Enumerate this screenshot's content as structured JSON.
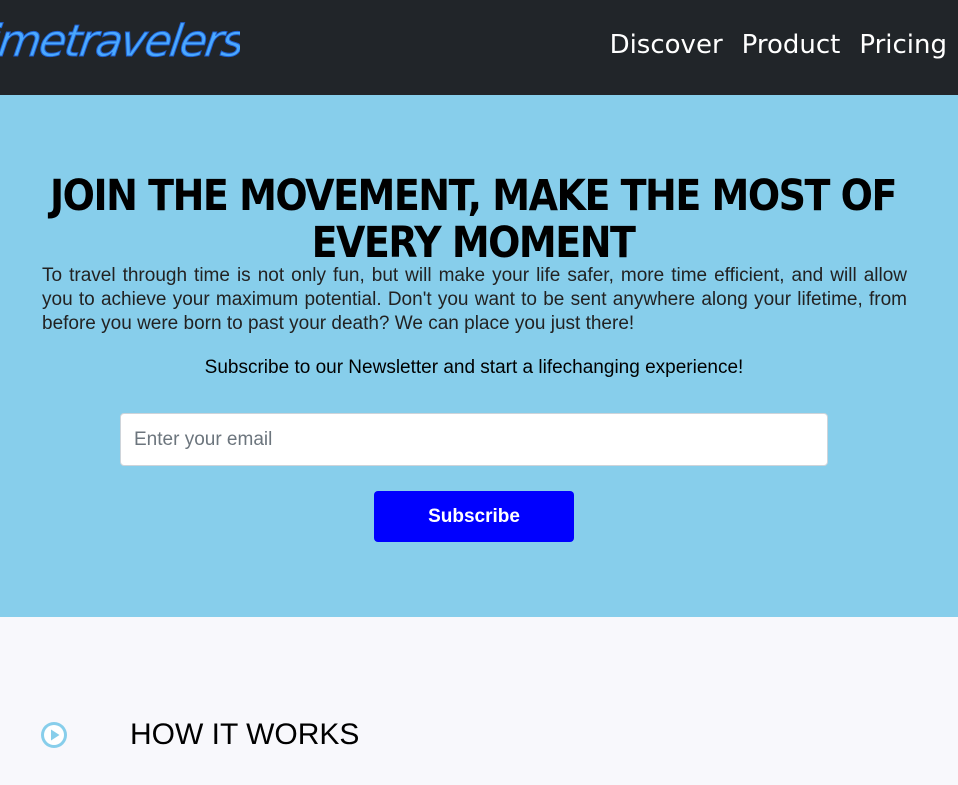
{
  "header": {
    "logo_text": "timetravelers",
    "nav": [
      {
        "label": "Discover"
      },
      {
        "label": "Product"
      },
      {
        "label": "Pricing"
      }
    ],
    "colors": {
      "background": "#212529",
      "logo": "#4aa8ff"
    }
  },
  "hero": {
    "title": "JOIN THE MOVEMENT, MAKE THE MOST OF EVERY MOMENT",
    "text": "To travel through time is not only fun, but will make your life safer, more time efficient, and will allow you to achieve your maximum potential. Don't you want to be sent anywhere along your lifetime, from before you were born to past your death? We can place you just there!",
    "subscribe_prompt": "Subscribe to our Newsletter and start a lifechanging experience!",
    "email_placeholder": "Enter your email",
    "email_value": "",
    "subscribe_label": "Subscribe",
    "colors": {
      "background": "#87ceeb",
      "button": "#0000ff"
    }
  },
  "how_it_works": {
    "icon": "play-circle-icon",
    "title": "HOW IT WORKS",
    "colors": {
      "icon": "#87ceeb",
      "background": "#f8f8fc"
    }
  }
}
